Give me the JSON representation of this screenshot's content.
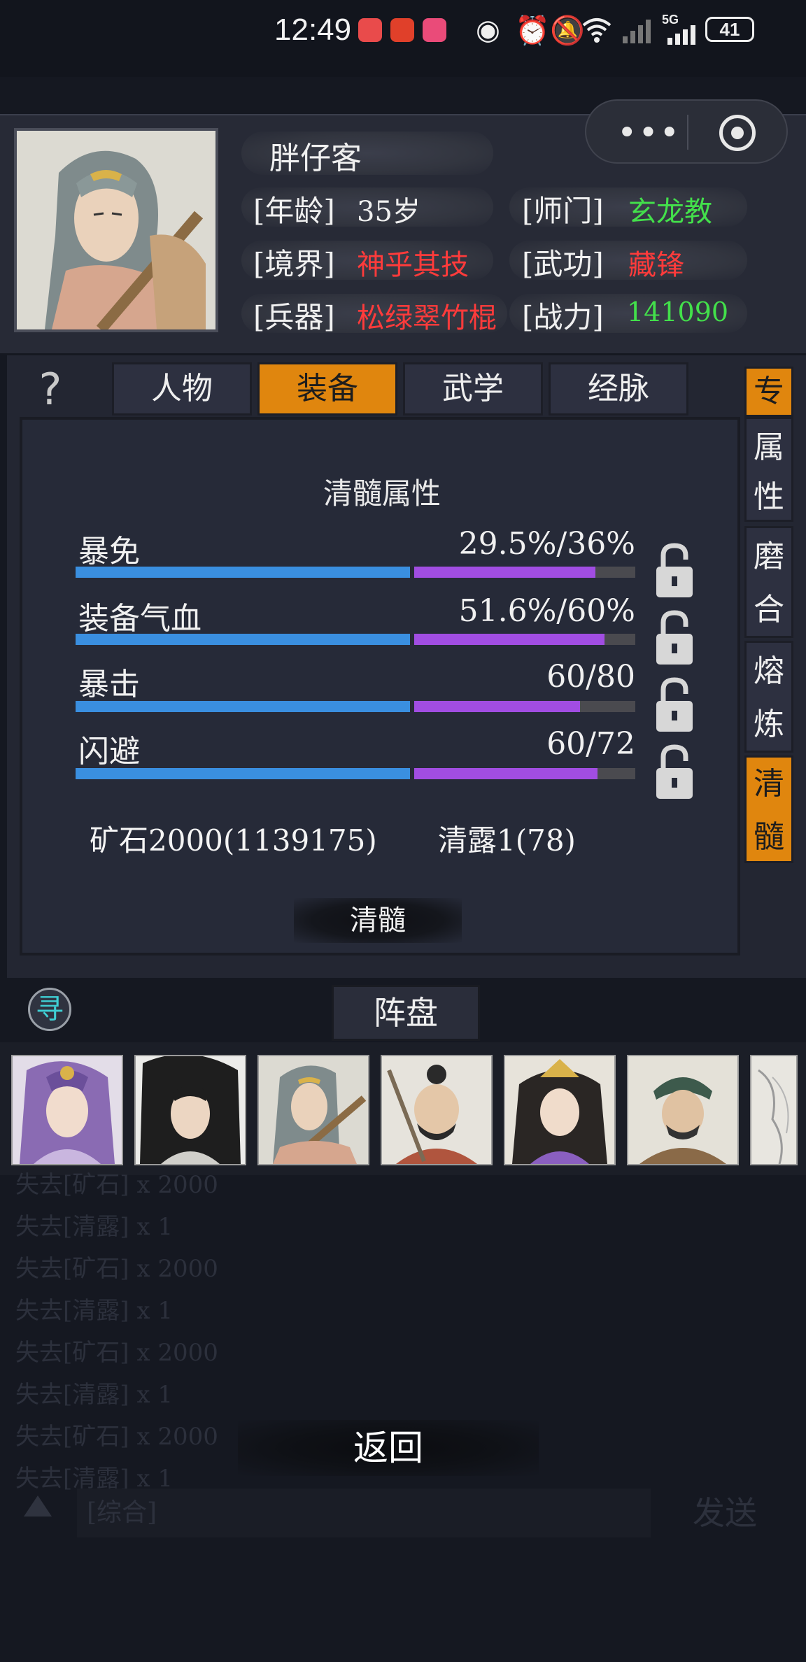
{
  "status_bar": {
    "time": "12:49",
    "network": "5G",
    "battery": "41",
    "icons": [
      "app-notification-icon",
      "app-notification-icon",
      "app-notification-icon",
      "eye-icon",
      "alarm-icon",
      "mute-icon",
      "wifi-icon",
      "signal-icon",
      "signal-5g-icon"
    ]
  },
  "character": {
    "name": "胖仔客",
    "age_label": "[年龄]",
    "age_value": "35岁",
    "sect_label": "[师门]",
    "sect_value": "玄龙教",
    "realm_label": "[境界]",
    "realm_value": "神乎其技",
    "skill_label": "[武功]",
    "skill_value": "藏锋",
    "weapon_label": "[兵器]",
    "weapon_value": "松绿翠竹棍",
    "power_label": "[战力]",
    "power_value": "141090"
  },
  "colors": {
    "accent": "#e0860e",
    "red": "#ff3b3b",
    "green": "#43e04b",
    "blue_bar": "#3a8fe0",
    "purple_bar": "#a14de2"
  },
  "tabs": [
    {
      "label": "人物",
      "active": false
    },
    {
      "label": "装备",
      "active": true
    },
    {
      "label": "武学",
      "active": false
    },
    {
      "label": "经脉",
      "active": false
    }
  ],
  "help_glyph": "?",
  "side_tabs": [
    {
      "label": "专属性",
      "active": false
    },
    {
      "label": "磨合",
      "active": false
    },
    {
      "label": "熔炼",
      "active": false
    },
    {
      "label": "清髓",
      "active": true
    }
  ],
  "refine": {
    "title": "清髓属性",
    "stats": [
      {
        "name": "暴免",
        "value": "29.5%/36%",
        "fill": 0.82
      },
      {
        "name": "装备气血",
        "value": "51.6%/60%",
        "fill": 0.86
      },
      {
        "name": "暴击",
        "value": "60/80",
        "fill": 0.75
      },
      {
        "name": "闪避",
        "value": "60/72",
        "fill": 0.83
      }
    ],
    "ore": "矿石2000(1139175)",
    "dew": "清露1(78)",
    "action_label": "清髓"
  },
  "formation": {
    "seek_glyph": "寻",
    "tab_label": "阵盘",
    "heroes": [
      "hero-purple-hair",
      "hero-black-hair",
      "hero-silver-hair",
      "hero-bearded",
      "hero-crowned",
      "hero-green-hat",
      "hero-partial"
    ]
  },
  "log": [
    "失去[矿石] x 2000",
    "失去[清露] x 1",
    "失去[矿石] x 2000",
    "失去[清露] x 1",
    "失去[矿石] x 2000",
    "失去[清露] x 1",
    "失去[矿石] x 2000",
    "失去[清露] x 1"
  ],
  "back_label": "返回",
  "chat": {
    "placeholder": "[综合]",
    "send_label": "发送"
  }
}
